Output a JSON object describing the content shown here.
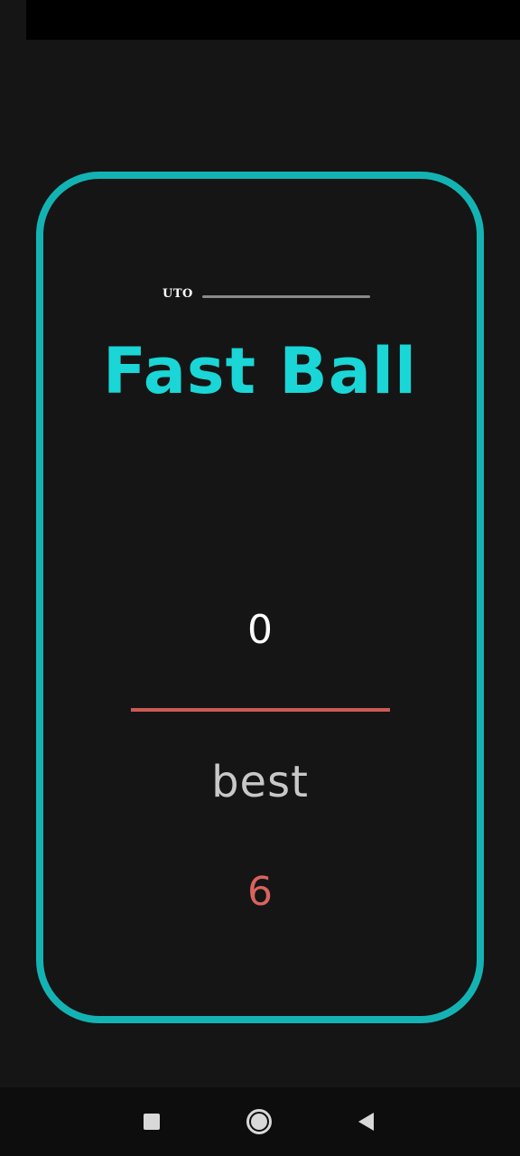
{
  "colors": {
    "background": "#151515",
    "card_border": "#14b3b3",
    "title": "#1ad6d6",
    "score": "#ffffff",
    "divider": "#cc5a55",
    "best_label": "#c8c8c8",
    "best_value": "#d9635e"
  },
  "loading": {
    "label": "UTO"
  },
  "game": {
    "title": "Fast Ball",
    "score": "0",
    "best_label": "best",
    "best_value": "6"
  },
  "nav": {
    "recents_icon": "square-icon",
    "home_icon": "circle-icon",
    "back_icon": "triangle-back-icon"
  }
}
